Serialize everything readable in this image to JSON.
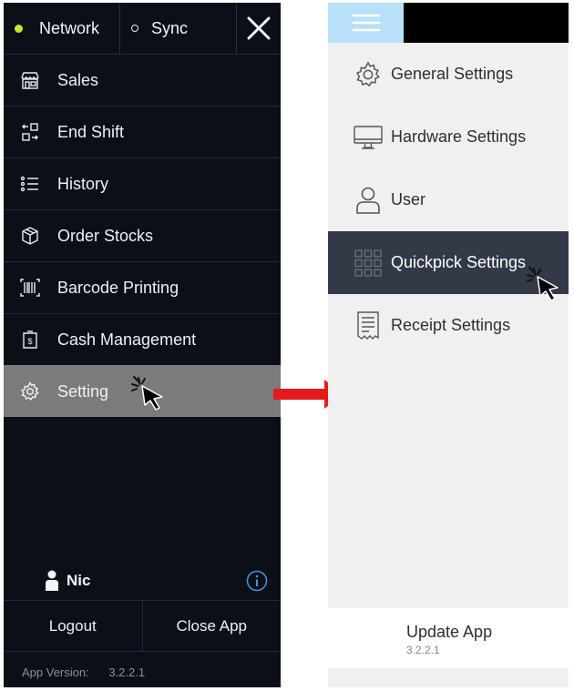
{
  "left_panel": {
    "network_label": "Network",
    "sync_label": "Sync",
    "menu": [
      {
        "label": "Sales",
        "icon": "store-icon"
      },
      {
        "label": "End Shift",
        "icon": "shift-icon"
      },
      {
        "label": "History",
        "icon": "list-icon"
      },
      {
        "label": "Order Stocks",
        "icon": "box-icon"
      },
      {
        "label": "Barcode Printing",
        "icon": "barcode-icon"
      },
      {
        "label": "Cash Management",
        "icon": "cash-icon"
      },
      {
        "label": "Setting",
        "icon": "gear-icon",
        "active": true
      }
    ],
    "user_name": "Nic",
    "logout_label": "Logout",
    "close_app_label": "Close App",
    "version_label": "App Version:",
    "version_value": "3.2.2.1"
  },
  "right_panel": {
    "settings": [
      {
        "label": "General Settings",
        "icon": "gear-icon"
      },
      {
        "label": "Hardware Settings",
        "icon": "monitor-icon"
      },
      {
        "label": "User",
        "icon": "user-icon"
      },
      {
        "label": "Quickpick Settings",
        "icon": "grid-icon",
        "active": true
      },
      {
        "label": "Receipt Settings",
        "icon": "receipt-icon"
      }
    ],
    "update_label": "Update App",
    "update_version": "3.2.2.1"
  },
  "colors": {
    "dark_bg": "#0b0f18",
    "active_gray": "#7a7b7d",
    "network_status_dot": "#c6e82a",
    "arrow_red": "#e51a1a",
    "hamburger_bg": "#b8e0f8",
    "active_dark": "#323a48",
    "info_blue": "#4a90e2"
  }
}
